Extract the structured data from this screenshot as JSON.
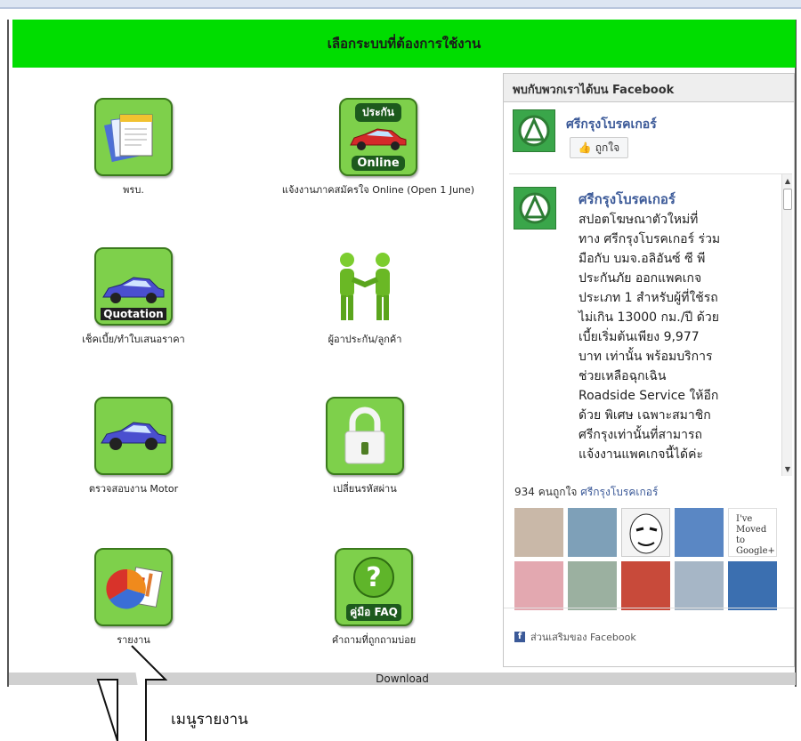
{
  "header": {
    "title": "เลือกระบบที่ต้องการใช้งาน"
  },
  "tiles": [
    {
      "label": "พรบ.",
      "icon": "documents-icon"
    },
    {
      "label": "แจ้งงานภาคสมัครใจ Online (Open 1 June)",
      "icon": "online-car-icon",
      "badge_top": "ประกัน",
      "badge_bottom": "Online"
    },
    {
      "label": "เช็คเบี้ย/ทำใบเสนอราคา",
      "icon": "quotation-car-icon",
      "badge": "Quotation"
    },
    {
      "label": "ผู้อาประกัน/ลูกค้า",
      "icon": "handshake-icon"
    },
    {
      "label": "ตรวจสอบงาน Motor",
      "icon": "car-icon"
    },
    {
      "label": "เปลี่ยนรหัสผ่าน",
      "icon": "padlock-icon"
    },
    {
      "label": "รายงาน",
      "icon": "pie-chart-icon"
    },
    {
      "label": "คำถามที่ถูกถามบ่อย",
      "icon": "faq-icon",
      "badge": "คู่มือ FAQ"
    }
  ],
  "facebook": {
    "title": "พบกับพวกเราได้บน Facebook",
    "page_name": "ศรีกรุงโบรคเกอร์",
    "like_label": "ถูกใจ",
    "post_author": "ศรีกรุงโบรคเกอร์",
    "post_lines": [
      "สปอตโฆษณาตัวใหม่ที่",
      "ทาง ศรีกรุงโบรคเกอร์ ร่วม",
      "มือกับ บมจ.อลิอันซ์ ซี พี",
      "ประกันภัย ออกแพคเกจ",
      "ประเภท 1 สำหรับผู้ที่ใช้รถ",
      "ไม่เกิน 13000 กม./ปี ด้วย",
      "เบี้ยเริ่มต้นเพียง 9,977",
      "บาท เท่านั้น พร้อมบริการ",
      "ช่วยเหลือฉุกเฉิน",
      "Roadside Service ให้อีก",
      "ด้วย พิเศษ เฉพาะสมาชิก",
      "ศรีกรุงเท่านั้นที่สามารถ",
      "แจ้งงานแพคเกจนี้ได้ค่ะ"
    ],
    "likes_count": "934 คนถูกใจ",
    "likes_page": "ศรีกรุงโบรคเกอร์",
    "face_caption": "I've Moved to Google+",
    "plugin_text": "ส่วนเสริมของ Facebook"
  },
  "download_label": "Download",
  "annotation": {
    "caption": "เมนูรายงาน"
  },
  "colors": {
    "header_green": "#00dd00",
    "tile_green": "#7ed04b",
    "fb_blue": "#3b5998"
  }
}
